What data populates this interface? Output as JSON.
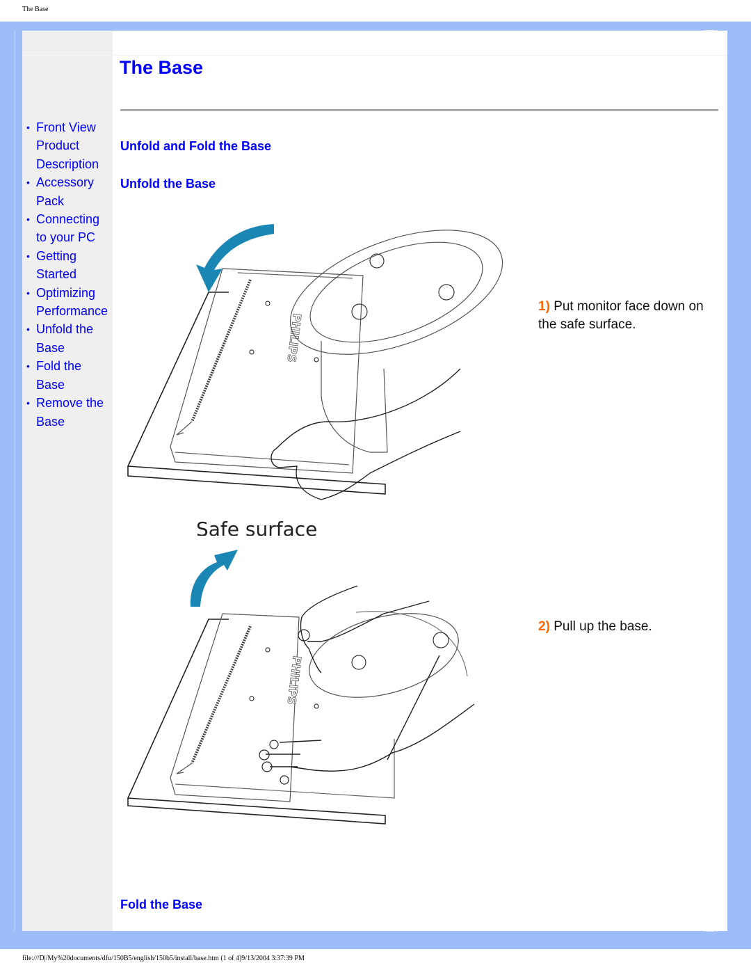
{
  "print_header": "The Base",
  "print_footer": "file:///D|/My%20documents/dfu/150B5/english/150b5/install/base.htm (1 of 4)9/13/2004 3:37:39 PM",
  "colors": {
    "frame": "#9dbdf9",
    "sidebar": "#efefef",
    "link": "#0000ff",
    "step_number": "#ff6600",
    "arrow": "#1a86b4"
  },
  "sidebar": {
    "items": [
      {
        "label": "Front View Product Description",
        "lines": [
          "Front View",
          "Product",
          "Description"
        ]
      },
      {
        "label": "Accessory Pack",
        "lines": [
          "Accessory",
          "Pack"
        ]
      },
      {
        "label": "Connecting to your PC",
        "lines": [
          "Connecting",
          "to your PC"
        ]
      },
      {
        "label": "Getting Started",
        "lines": [
          "Getting",
          "Started"
        ]
      },
      {
        "label": "Optimizing Performance",
        "lines": [
          "Optimizing",
          "Performance"
        ]
      },
      {
        "label": "Unfold the Base",
        "lines": [
          "Unfold the",
          "Base"
        ]
      },
      {
        "label": "Fold the Base",
        "lines": [
          "Fold the",
          "Base"
        ]
      },
      {
        "label": "Remove the Base",
        "lines": [
          "Remove the",
          "Base"
        ]
      }
    ],
    "bullet": "•"
  },
  "main": {
    "title": "The Base",
    "section_heading": "Unfold and Fold the Base",
    "subsection_unfold": "Unfold the Base",
    "subsection_fold": "Fold the Base",
    "figure1_caption": "Safe surface",
    "figure1_brand": "PHILIPS",
    "figure2_brand": "PHILIPS",
    "steps": [
      {
        "number": "1)",
        "text": "Put monitor face down on the safe surface."
      },
      {
        "number": "2)",
        "text": "Pull up the base."
      }
    ]
  }
}
